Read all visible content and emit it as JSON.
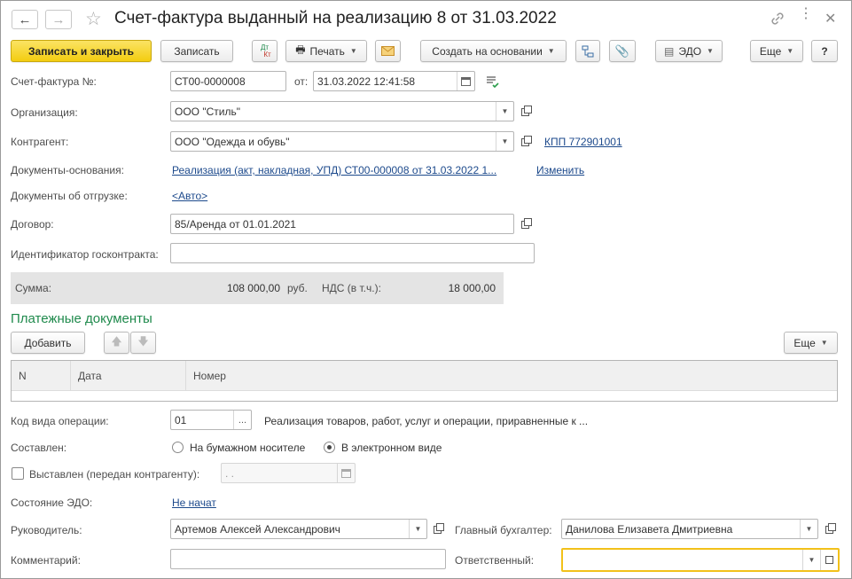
{
  "window": {
    "title": "Счет-фактура выданный на реализацию 8 от 31.03.2022"
  },
  "toolbar": {
    "save_close": "Записать и закрыть",
    "save": "Записать",
    "dtkt_top": "Дт",
    "dtkt_bottom": "Кт",
    "print": "Печать",
    "create_based": "Создать на основании",
    "edo": "ЭДО",
    "more": "Еще",
    "help": "?"
  },
  "form": {
    "invoice_label": "Счет-фактура №:",
    "invoice_number": "СТ00-0000008",
    "from_label": "от:",
    "date": "31.03.2022 12:41:58",
    "org_label": "Организация:",
    "org_value": "ООО \"Стиль\"",
    "contractor_label": "Контрагент:",
    "contractor_value": "ООО \"Одежда и обувь\"",
    "kpp_link": "КПП 772901001",
    "basis_label": "Документы-основания:",
    "basis_link": "Реализация (акт, накладная, УПД) СТ00-000008 от 31.03.2022 1...",
    "change_link": "Изменить",
    "shipment_label": "Документы об отгрузке:",
    "shipment_link": "<Авто>",
    "contract_label": "Договор:",
    "contract_value": "85/Аренда от 01.01.2021",
    "gov_label": "Идентификатор госконтракта:",
    "gov_value": ""
  },
  "summary": {
    "sum_label": "Сумма:",
    "sum_value": "108 000,00",
    "currency": "руб.",
    "vat_label": "НДС (в т.ч.):",
    "vat_value": "18 000,00"
  },
  "payments": {
    "title": "Платежные документы",
    "add": "Добавить",
    "more": "Еще",
    "columns": [
      "N",
      "Дата",
      "Номер"
    ],
    "rows": []
  },
  "operation": {
    "code_label": "Код вида операции:",
    "code_value": "01",
    "code_desc": "Реализация товаров, работ, услуг и операции, приравненные к ...",
    "composed_label": "Составлен:",
    "paper": "На бумажном носителе",
    "electronic": "В электронном виде",
    "composed_selected": "electronic",
    "issued_label": "Выставлен (передан контрагенту):",
    "issued_checked": false,
    "issued_date": " .  .",
    "edo_state_label": "Состояние ЭДО:",
    "edo_state_link": "Не начат"
  },
  "signatures": {
    "head_label": "Руководитель:",
    "head_value": "Артемов Алексей Александрович",
    "accountant_label": "Главный бухгалтер:",
    "accountant_value": "Данилова Елизавета Дмитриевна",
    "comment_label": "Комментарий:",
    "comment_value": "",
    "responsible_label": "Ответственный:",
    "responsible_value": ""
  },
  "colors": {
    "primary_button": "#f3cd10",
    "section_title": "#1f8a4c",
    "link": "#1d4a8c",
    "focus_border": "#f2c11a"
  }
}
